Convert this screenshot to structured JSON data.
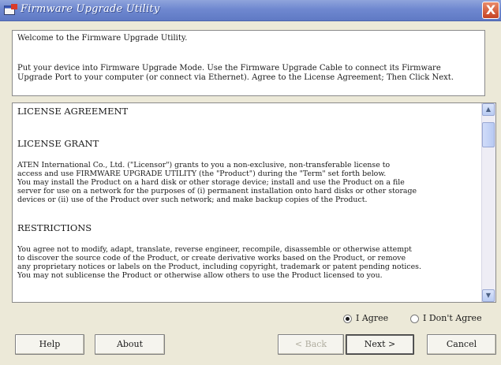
{
  "window": {
    "title": "Firmware Upgrade Utility",
    "close_label": "X"
  },
  "intro": {
    "welcome": "Welcome to the Firmware Upgrade Utility.",
    "instructions_line1": "Put your device into Firmware Upgrade Mode. Use the Firmware Upgrade Cable to connect its Firmware",
    "instructions_line2": "Upgrade Port to your computer (or connect via Ethernet). Agree to the License Agreement; Then Click Next."
  },
  "license": {
    "heading": "LICENSE AGREEMENT",
    "grant_heading": "LICENSE GRANT",
    "grant_lines": [
      "ATEN International Co., Ltd. (\"Licensor\") grants to you a non-exclusive, non-transferable license to",
      "access and use FIRMWARE UPGRADE UTILITY (the \"Product\") during the \"Term\" set forth below.",
      "You may install the Product on a hard disk or other storage device; install and use the Product on a file",
      "server for use on a network for the purposes of (i) permanent installation onto hard disks or other storage",
      "devices or (ii) use of the Product over such network; and make backup copies of the Product."
    ],
    "restrictions_heading": "RESTRICTIONS",
    "restrictions_lines": [
      "You agree not to modify, adapt, translate, reverse engineer, recompile, disassemble or otherwise attempt",
      "to discover the source code of the Product, or create derivative works based on the Product, or remove",
      "any proprietary notices or labels on the Product, including copyright, trademark or patent pending notices.",
      "You may not sublicense the Product or otherwise allow others to use the Product licensed to you."
    ]
  },
  "choice": {
    "agree_label": "I Agree",
    "disagree_label": "I Don't Agree",
    "selected": "agree"
  },
  "buttons": {
    "help": "Help",
    "about": "About",
    "back": "< Back",
    "next": "Next >",
    "cancel": "Cancel"
  },
  "colors": {
    "titlebar": "#6f88d0",
    "window_bg": "#ece9d8",
    "close": "#c64222"
  },
  "icons": {
    "app": "app-window-icon",
    "scroll_up": "arrow-up-icon",
    "scroll_down": "arrow-down-icon",
    "close": "close-icon"
  }
}
